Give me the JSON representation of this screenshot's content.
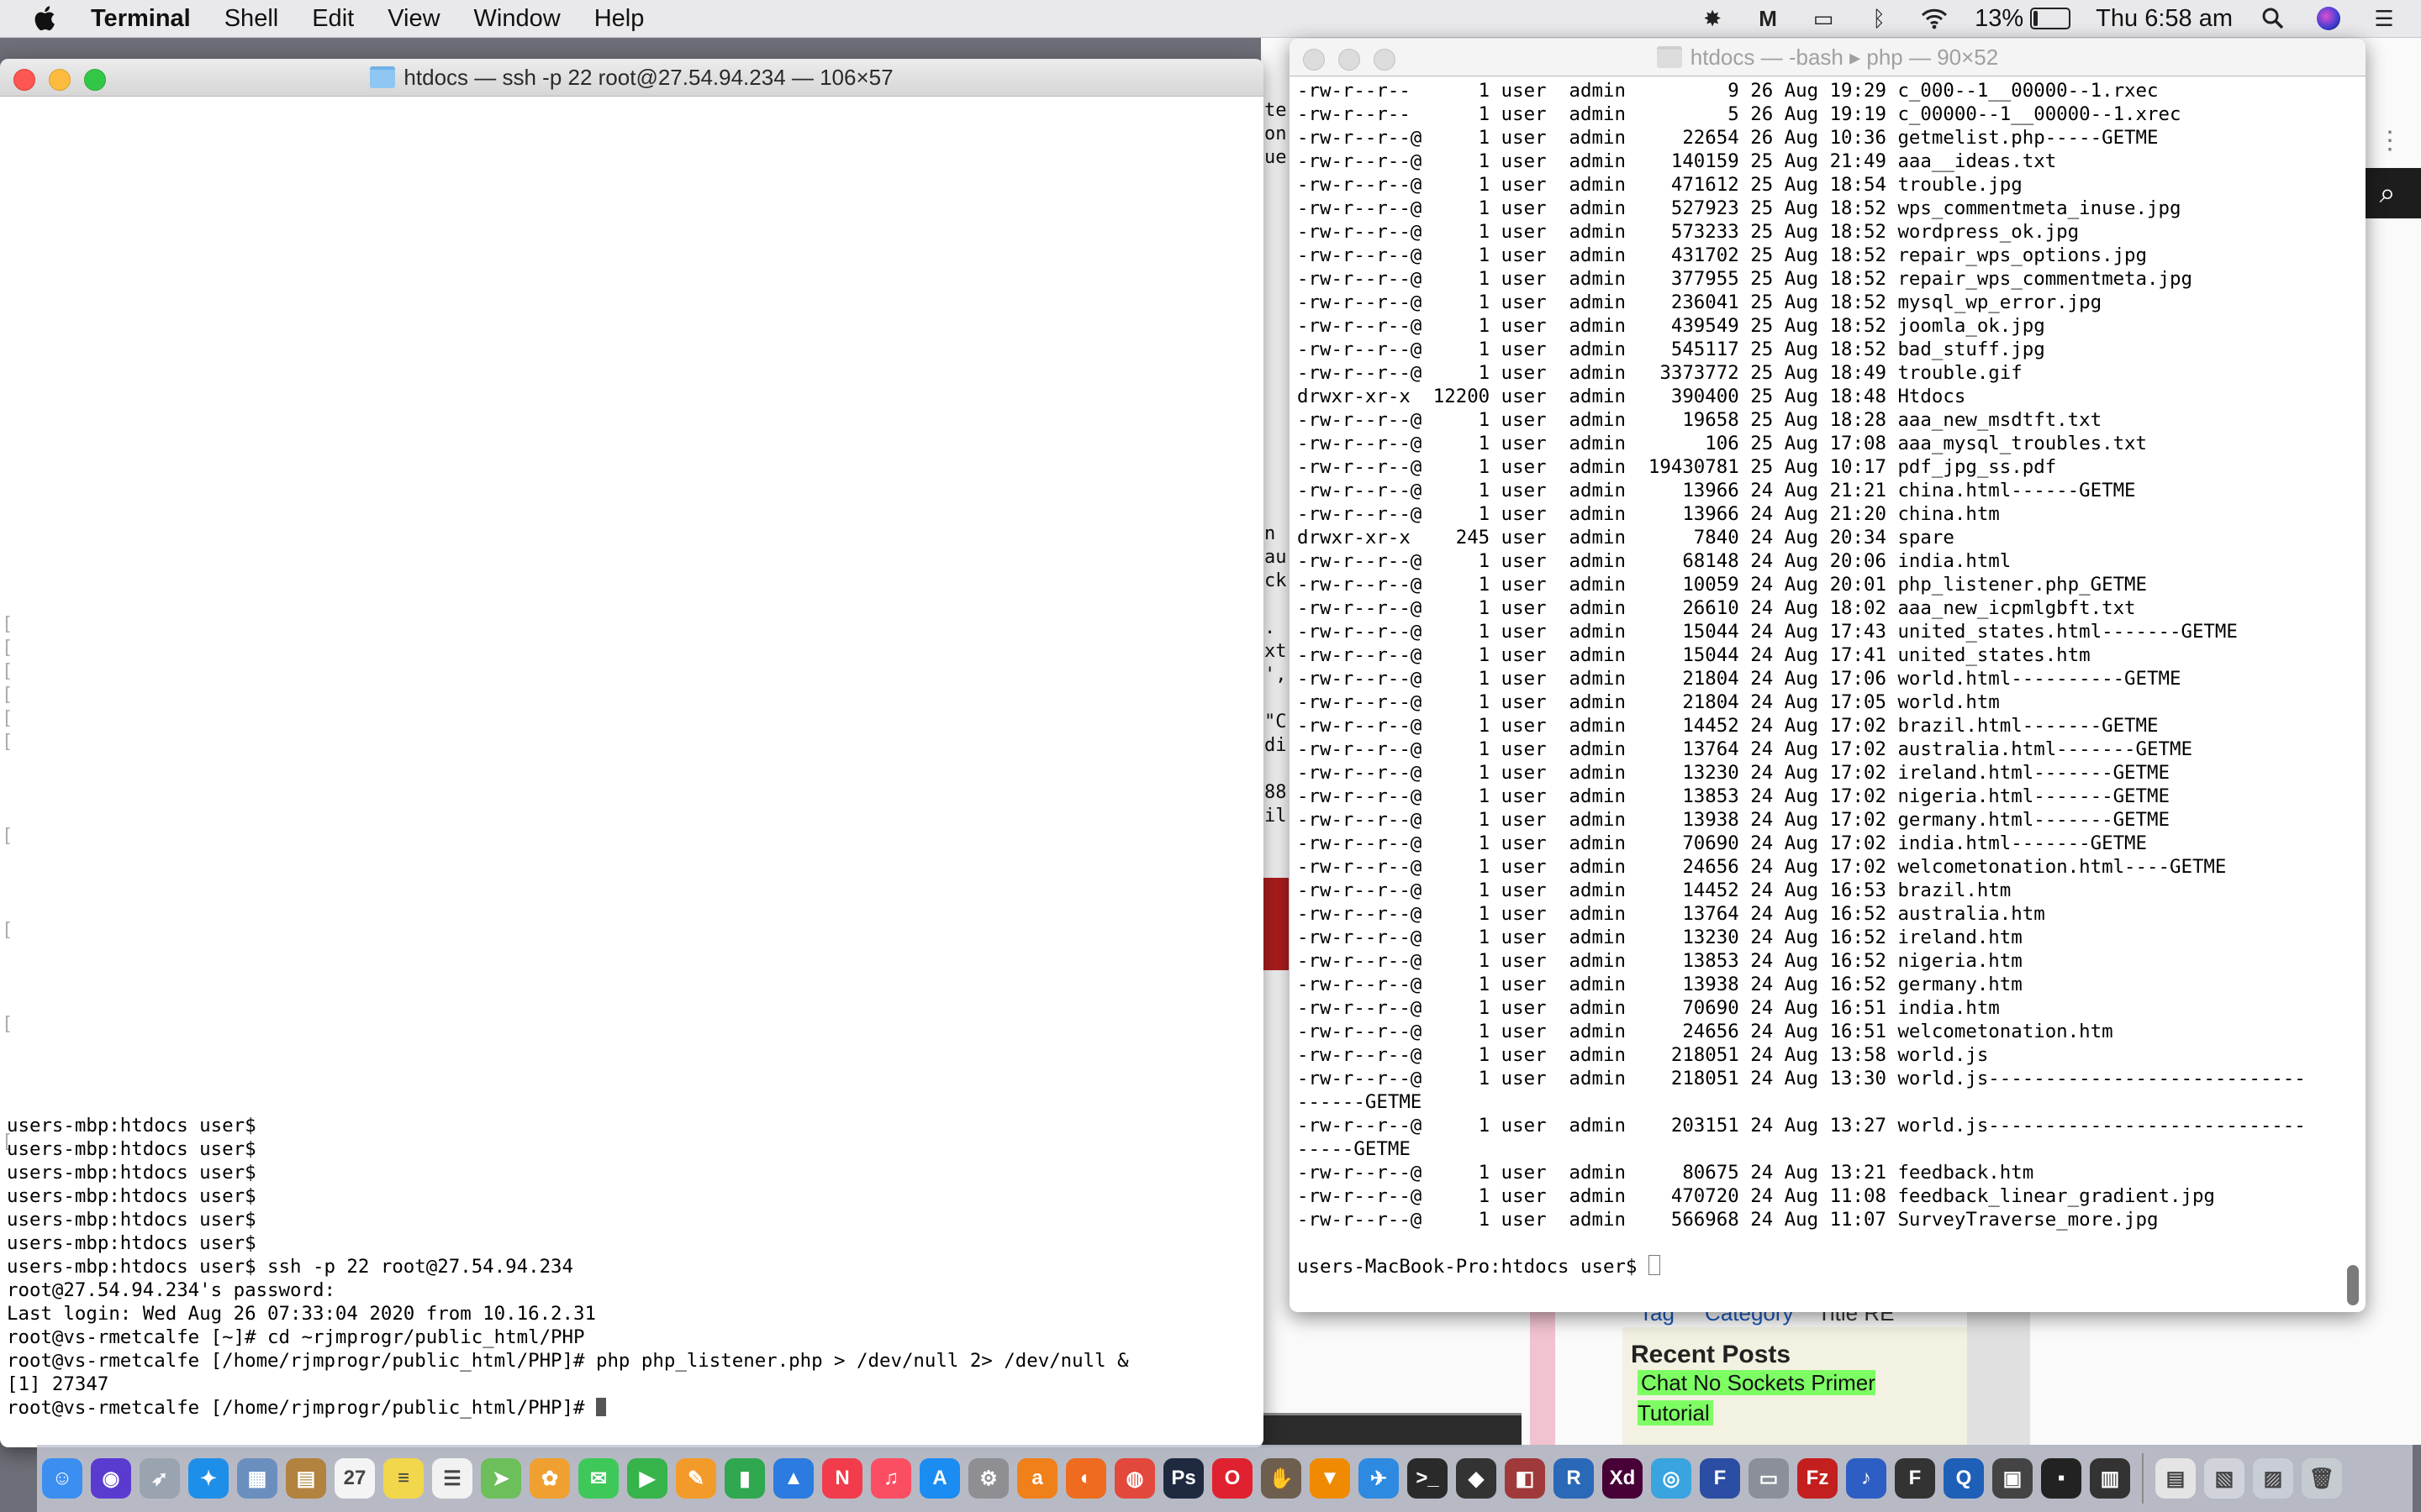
{
  "menubar": {
    "app_name": "Terminal",
    "items": [
      "Shell",
      "Edit",
      "View",
      "Window",
      "Help"
    ],
    "battery": "13%",
    "clock": "Thu 6:58 am",
    "status_icons": [
      "script-icon",
      "gmail-icon",
      "airplay-icon",
      "bluetooth-icon",
      "wifi-icon"
    ]
  },
  "left_window": {
    "title": "htdocs — ssh -p 22 root@27.54.94.234 — 106×57",
    "lines": [
      "users-mbp:htdocs user$",
      "users-mbp:htdocs user$",
      "users-mbp:htdocs user$",
      "users-mbp:htdocs user$",
      "users-mbp:htdocs user$",
      "users-mbp:htdocs user$",
      "users-mbp:htdocs user$ ssh -p 22 root@27.54.94.234",
      "root@27.54.94.234's password:",
      "Last login: Wed Aug 26 07:33:04 2020 from 10.16.2.31",
      "root@vs-rmetcalfe [~]# cd ~rjmprogr/public_html/PHP",
      "root@vs-rmetcalfe [/home/rjmprogr/public_html/PHP]# php php_listener.php > /dev/null 2> /dev/null &",
      "[1] 27347",
      "root@vs-rmetcalfe [/home/rjmprogr/public_html/PHP]# "
    ]
  },
  "right_window": {
    "title": "htdocs — -bash ▸ php — 90×52",
    "listing": [
      "-rw-r--r--      1 user  admin         9 26 Aug 19:29 c_000--1__00000--1.rxec",
      "-rw-r--r--      1 user  admin         5 26 Aug 19:19 c_00000--1__00000--1.xrec",
      "-rw-r--r--@     1 user  admin     22654 26 Aug 10:36 getmelist.php-----GETME",
      "-rw-r--r--@     1 user  admin    140159 25 Aug 21:49 aaa__ideas.txt",
      "-rw-r--r--@     1 user  admin    471612 25 Aug 18:54 trouble.jpg",
      "-rw-r--r--@     1 user  admin    527923 25 Aug 18:52 wps_commentmeta_inuse.jpg",
      "-rw-r--r--@     1 user  admin    573233 25 Aug 18:52 wordpress_ok.jpg",
      "-rw-r--r--@     1 user  admin    431702 25 Aug 18:52 repair_wps_options.jpg",
      "-rw-r--r--@     1 user  admin    377955 25 Aug 18:52 repair_wps_commentmeta.jpg",
      "-rw-r--r--@     1 user  admin    236041 25 Aug 18:52 mysql_wp_error.jpg",
      "-rw-r--r--@     1 user  admin    439549 25 Aug 18:52 joomla_ok.jpg",
      "-rw-r--r--@     1 user  admin    545117 25 Aug 18:52 bad_stuff.jpg",
      "-rw-r--r--@     1 user  admin   3373772 25 Aug 18:49 trouble.gif",
      "drwxr-xr-x  12200 user  admin    390400 25 Aug 18:48 Htdocs",
      "-rw-r--r--@     1 user  admin     19658 25 Aug 18:28 aaa_new_msdtft.txt",
      "-rw-r--r--@     1 user  admin       106 25 Aug 17:08 aaa_mysql_troubles.txt",
      "-rw-r--r--@     1 user  admin  19430781 25 Aug 10:17 pdf_jpg_ss.pdf",
      "-rw-r--r--@     1 user  admin     13966 24 Aug 21:21 china.html------GETME",
      "-rw-r--r--@     1 user  admin     13966 24 Aug 21:20 china.htm",
      "drwxr-xr-x    245 user  admin      7840 24 Aug 20:34 spare",
      "-rw-r--r--@     1 user  admin     68148 24 Aug 20:06 india.html",
      "-rw-r--r--@     1 user  admin     10059 24 Aug 20:01 php_listener.php_GETME",
      "-rw-r--r--@     1 user  admin     26610 24 Aug 18:02 aaa_new_icpmlgbft.txt",
      "-rw-r--r--@     1 user  admin     15044 24 Aug 17:43 united_states.html-------GETME",
      "-rw-r--r--@     1 user  admin     15044 24 Aug 17:41 united_states.htm",
      "-rw-r--r--@     1 user  admin     21804 24 Aug 17:06 world.html----------GETME",
      "-rw-r--r--@     1 user  admin     21804 24 Aug 17:05 world.htm",
      "-rw-r--r--@     1 user  admin     14452 24 Aug 17:02 brazil.html-------GETME",
      "-rw-r--r--@     1 user  admin     13764 24 Aug 17:02 australia.html-------GETME",
      "-rw-r--r--@     1 user  admin     13230 24 Aug 17:02 ireland.html-------GETME",
      "-rw-r--r--@     1 user  admin     13853 24 Aug 17:02 nigeria.html-------GETME",
      "-rw-r--r--@     1 user  admin     13938 24 Aug 17:02 germany.html-------GETME",
      "-rw-r--r--@     1 user  admin     70690 24 Aug 17:02 india.html-------GETME",
      "-rw-r--r--@     1 user  admin     24656 24 Aug 17:02 welcometonation.html----GETME",
      "-rw-r--r--@     1 user  admin     14452 24 Aug 16:53 brazil.htm",
      "-rw-r--r--@     1 user  admin     13764 24 Aug 16:52 australia.htm",
      "-rw-r--r--@     1 user  admin     13230 24 Aug 16:52 ireland.htm",
      "-rw-r--r--@     1 user  admin     13853 24 Aug 16:52 nigeria.htm",
      "-rw-r--r--@     1 user  admin     13938 24 Aug 16:52 germany.htm",
      "-rw-r--r--@     1 user  admin     70690 24 Aug 16:51 india.htm",
      "-rw-r--r--@     1 user  admin     24656 24 Aug 16:51 welcometonation.htm",
      "-rw-r--r--@     1 user  admin    218051 24 Aug 13:58 world.js",
      "-rw-r--r--@     1 user  admin    218051 24 Aug 13:30 world.js----------------------------",
      "------GETME",
      "-rw-r--r--@     1 user  admin    203151 24 Aug 13:27 world.js----------------------------",
      "-----GETME",
      "-rw-r--r--@     1 user  admin     80675 24 Aug 13:21 feedback.htm",
      "-rw-r--r--@     1 user  admin    470720 24 Aug 11:08 feedback_linear_gradient.jpg",
      "-rw-r--r--@     1 user  admin    566968 24 Aug 11:07 SurveyTraverse_more.jpg"
    ],
    "prompt": "users-MacBook-Pro:htdocs user$ "
  },
  "background_page": {
    "recent_heading": "Recent Posts",
    "recent_post_title": "Chat No Sockets Primer Tutorial",
    "filter_tag": "Tag",
    "filter_category": "Category",
    "filter_title": "Title RE",
    "peek_text_top": [
      "te",
      "on",
      "ue"
    ],
    "peek_text_mid": [
      " n",
      "au",
      "ck",
      "",
      " .",
      "xt",
      "',",
      "",
      "\"C",
      "di",
      "",
      "88",
      "il"
    ]
  },
  "dock": {
    "apps": [
      {
        "name": "finder-icon",
        "color": "#3b8ff0",
        "glyph": "☺"
      },
      {
        "name": "siri-icon",
        "color": "#5a3bd0",
        "glyph": "◉"
      },
      {
        "name": "launchpad-icon",
        "color": "#9aa3b0",
        "glyph": "➶"
      },
      {
        "name": "safari-icon",
        "color": "#1e8fe8",
        "glyph": "✦"
      },
      {
        "name": "preview-icon",
        "color": "#6a8fbf",
        "glyph": "▦"
      },
      {
        "name": "notefile-icon",
        "color": "#b2823f",
        "glyph": "▤"
      },
      {
        "name": "calendar-icon",
        "color": "#f4f4f4",
        "glyph": "27"
      },
      {
        "name": "notes-icon",
        "color": "#f2d64b",
        "glyph": "≡"
      },
      {
        "name": "reminders-icon",
        "color": "#f2f2f2",
        "glyph": "☰"
      },
      {
        "name": "maps-icon",
        "color": "#6cbf5a",
        "glyph": "➤"
      },
      {
        "name": "photos-icon",
        "color": "#f0a030",
        "glyph": "✿"
      },
      {
        "name": "messages-icon",
        "color": "#3fc85a",
        "glyph": "✉"
      },
      {
        "name": "facetime-icon",
        "color": "#36b34a",
        "glyph": "▶"
      },
      {
        "name": "pages-icon",
        "color": "#f29b2b",
        "glyph": "✎"
      },
      {
        "name": "numbers-icon",
        "color": "#2fa84f",
        "glyph": "▮"
      },
      {
        "name": "keynote-icon",
        "color": "#2b7be0",
        "glyph": "▲"
      },
      {
        "name": "news-icon",
        "color": "#f23c4c",
        "glyph": "N"
      },
      {
        "name": "music-icon",
        "color": "#fb4e62",
        "glyph": "♫"
      },
      {
        "name": "appstore-icon",
        "color": "#1b8cf2",
        "glyph": "A"
      },
      {
        "name": "settings-icon",
        "color": "#8e8e93",
        "glyph": "⚙"
      },
      {
        "name": "audacity-icon",
        "color": "#f08019",
        "glyph": "a"
      },
      {
        "name": "firefox-icon",
        "color": "#ef6b1f",
        "glyph": "◐"
      },
      {
        "name": "chrome-icon",
        "color": "#e2483b",
        "glyph": "◍"
      },
      {
        "name": "photoshop-icon",
        "color": "#1f2a40",
        "glyph": "Ps"
      },
      {
        "name": "opera-icon",
        "color": "#e0212f",
        "glyph": "O"
      },
      {
        "name": "gimp-icon",
        "color": "#6e5e4e",
        "glyph": "✋"
      },
      {
        "name": "vlc-icon",
        "color": "#f08a00",
        "glyph": "▼"
      },
      {
        "name": "xcode-icon",
        "color": "#2d8ae0",
        "glyph": "✈"
      },
      {
        "name": "terminal-icon",
        "color": "#2a2a2a",
        "glyph": ">_"
      },
      {
        "name": "inkscape-icon",
        "color": "#333333",
        "glyph": "◆"
      },
      {
        "name": "filemerge-icon",
        "color": "#a03a3a",
        "glyph": "◧"
      },
      {
        "name": "r-icon",
        "color": "#2a68b8",
        "glyph": "R"
      },
      {
        "name": "xd-icon",
        "color": "#470137",
        "glyph": "Xd"
      },
      {
        "name": "ball-icon",
        "color": "#3aa4e0",
        "glyph": "◎"
      },
      {
        "name": "flow-icon",
        "color": "#2b4da3",
        "glyph": "F"
      },
      {
        "name": "diskutil-icon",
        "color": "#8a8f99",
        "glyph": "▭"
      },
      {
        "name": "filezilla-icon",
        "color": "#c41f1f",
        "glyph": "Fz"
      },
      {
        "name": "headphones-icon",
        "color": "#2d5ec4",
        "glyph": "♪"
      },
      {
        "name": "fontbook-icon",
        "color": "#333333",
        "glyph": "F"
      },
      {
        "name": "quicktime-icon",
        "color": "#1e5fb8",
        "glyph": "Q"
      },
      {
        "name": "console-icon",
        "color": "#444444",
        "glyph": "▣"
      },
      {
        "name": "terminal2-icon",
        "color": "#222222",
        "glyph": "▪"
      },
      {
        "name": "misc-icon",
        "color": "#333333",
        "glyph": "▥"
      },
      {
        "name": "doc-icon",
        "color": "#e4e4e4",
        "glyph": "▤"
      },
      {
        "name": "downloads-icon",
        "color": "#d0d4da",
        "glyph": "▧"
      },
      {
        "name": "folder-icon",
        "color": "#c9ced6",
        "glyph": "▨"
      },
      {
        "name": "trash-icon",
        "color": "#c6cbd2",
        "glyph": "🗑"
      }
    ]
  }
}
